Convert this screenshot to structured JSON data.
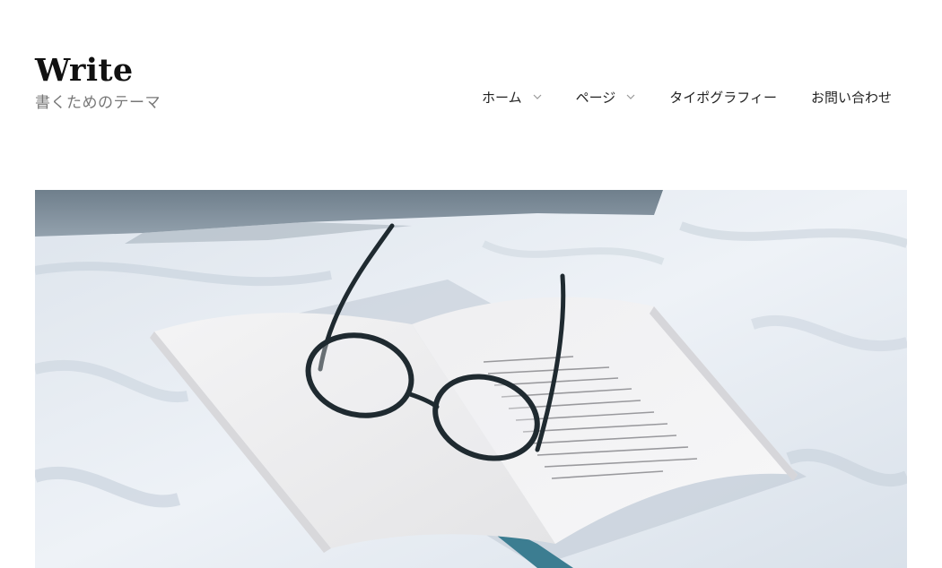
{
  "site": {
    "title": "Write",
    "description": "書くためのテーマ"
  },
  "nav": {
    "items": [
      {
        "label": "ホーム",
        "icon": "chevron-down-icon",
        "has_dropdown": true
      },
      {
        "label": "ページ",
        "icon": "chevron-down-icon",
        "has_dropdown": true
      },
      {
        "label": "タイポグラフィー",
        "has_dropdown": false
      },
      {
        "label": "お問い合わせ",
        "has_dropdown": false
      }
    ]
  },
  "hero": {
    "image": "eyeglasses-on-open-book-photo"
  },
  "colors": {
    "title": "#111111",
    "description": "#777777",
    "nav_text": "#222222",
    "caret": "#999999"
  }
}
